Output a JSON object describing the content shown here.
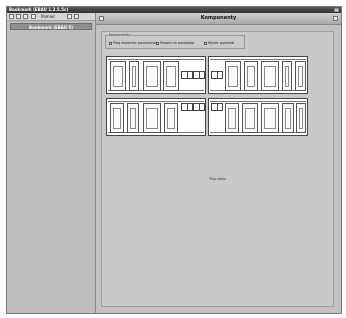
{
  "window": {
    "title": "Bookmark (EBAU 1.2.5.5c)"
  },
  "left_pane": {
    "toolbar_label": "Pamiec",
    "selected_item": "Bookmark (EBAU 5)"
  },
  "right_pane": {
    "title": "Komponenty",
    "group_label": "Komponenty",
    "options": [
      {
        "label": "Pieg dwiemiar poziomowy",
        "checked": false
      },
      {
        "label": "Pozwol na pozostale",
        "checked": false
      },
      {
        "label": "Wyzer wyswietl",
        "checked": false
      }
    ],
    "status_text": "Pop stalo"
  }
}
